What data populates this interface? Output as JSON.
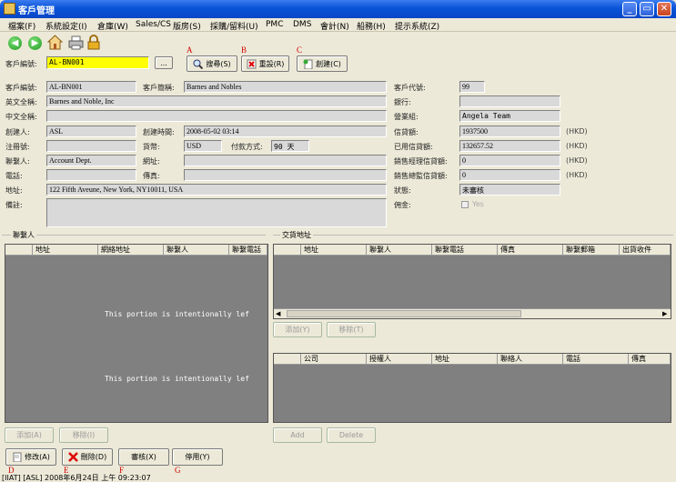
{
  "window": {
    "title": "客戶管理"
  },
  "menu": [
    "檔案(F)",
    "系統設定(I)",
    "倉庫(W)",
    "Sales/CS",
    "版房(S)",
    "採購/留料(U)",
    "PMC",
    "DMS",
    "會計(N)",
    "船務(H)",
    "提示系統(Z)"
  ],
  "search": {
    "customer_code_label": "客戶編號:",
    "customer_code_value": "AL-BN001",
    "ellipsis": "...",
    "search_button": "搜尋(S)",
    "reset_button": "重設(R)",
    "create_button": "創建(C)"
  },
  "markers": {
    "A": "A",
    "B": "B",
    "C": "C",
    "D": "D",
    "E": "E",
    "F": "F",
    "G": "G"
  },
  "form": {
    "code_label": "客戶編號:",
    "code": "AL-BN001",
    "short_label": "客戶簡稱:",
    "short": "Barnes and Nobles",
    "en_name_label": "英文全稱:",
    "en_name": "Barnes and Noble, Inc",
    "cn_name_label": "中文全稱:",
    "cn_name": "",
    "creator_label": "創建人:",
    "creator": "ASL",
    "created_time_label": "創建時間:",
    "created_time": "2008-05-02 03:14",
    "reg_label": "注冊號:",
    "reg": "",
    "currency_label": "貨幣:",
    "currency": "USD",
    "payment_label": "付款方式:",
    "payment": "90 天",
    "contact_label": "聯繫人:",
    "contact": "Account Dept.",
    "website_label": "網址:",
    "website": "",
    "phone_label": "電話:",
    "phone": "",
    "fax_label": "傳真:",
    "fax": "",
    "address_label": "地址:",
    "address": "122 Fifth Aveune, New York, NY10011, USA",
    "remark_label": "備註:",
    "remark": "",
    "cust_id_label": "客戶代號:",
    "cust_id": "99",
    "bank_label": "銀行:",
    "bank": "",
    "sales_group_label": "營業組:",
    "sales_group": "Angela Team",
    "credit_label": "信貸額:",
    "credit": "1937500",
    "credit_used_label": "已用信貸額:",
    "credit_used": "132657.52",
    "mgr_credit_label": "銷售經理信貸額:",
    "mgr_credit": "0",
    "dir_credit_label": "銷售總監信貸額:",
    "dir_credit": "0",
    "status_label": "狀態:",
    "status": "未審核",
    "commission_label": "佣金:",
    "commission_check": "Yes",
    "hkd": "(HKD)"
  },
  "contacts": {
    "group_title": "聯繫人",
    "columns": [
      "地址",
      "網絡地址",
      "聯繫人",
      "聯繫電話"
    ],
    "placeholder": "This portion is intentionally lef",
    "add": "添加(A)",
    "remove": "移除(I)"
  },
  "shipping": {
    "group_title": "交貨地址",
    "columns": [
      "地址",
      "聯繫人",
      "聯繫電話",
      "傳真",
      "聯繫郵箱",
      "出貨收件"
    ],
    "add": "添加(Y)",
    "remove": "移除(T)"
  },
  "companies": {
    "columns": [
      "公司",
      "授權人",
      "地址",
      "聯絡人",
      "電話",
      "傳真"
    ],
    "placeholder": "This portion is intentionally lef",
    "add": "Add",
    "delete": "Delete"
  },
  "actions": {
    "modify": "修改(A)",
    "delete": "刪除(D)",
    "review": "審核(X)",
    "disable": "停用(Y)"
  },
  "statusbar": {
    "text": "[IIAT] [ASL] 2008年6月24日 上午 09:23:07"
  }
}
